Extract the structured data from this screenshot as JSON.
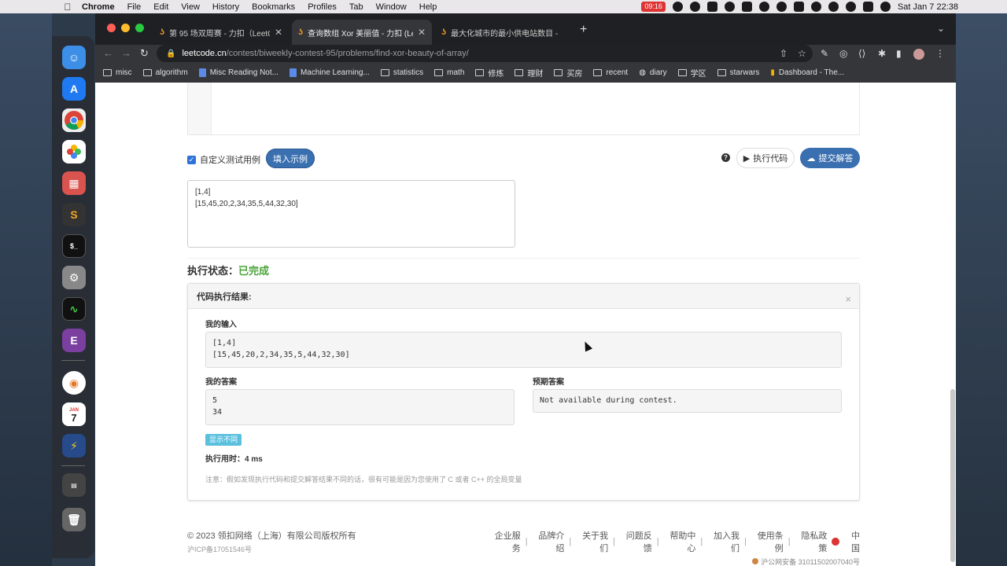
{
  "menubar": {
    "app_name": "Chrome",
    "items": [
      "File",
      "Edit",
      "View",
      "History",
      "Bookmarks",
      "Profiles",
      "Tab",
      "Window",
      "Help"
    ],
    "recording_time": "09:16",
    "clock": "Sat Jan 7  22:38"
  },
  "browser": {
    "tabs": [
      {
        "label": "第 95 场双周赛 - 力扣（LeetCo",
        "active": false
      },
      {
        "label": "查询数组 Xor 美丽值 - 力扣 (Le",
        "active": true
      },
      {
        "label": "最大化城市的最小供电站数目 - ",
        "active": false
      }
    ],
    "url_host": "leetcode.cn",
    "url_path": "/contest/biweekly-contest-95/problems/find-xor-beauty-of-array/",
    "bookmarks": [
      {
        "label": "misc",
        "type": "folder"
      },
      {
        "label": "algorithm",
        "type": "folder"
      },
      {
        "label": "Misc Reading Not...",
        "type": "doc"
      },
      {
        "label": "Machine Learning...",
        "type": "doc"
      },
      {
        "label": "statistics",
        "type": "folder"
      },
      {
        "label": "math",
        "type": "folder"
      },
      {
        "label": "修炼",
        "type": "folder"
      },
      {
        "label": "理财",
        "type": "folder"
      },
      {
        "label": "买房",
        "type": "folder"
      },
      {
        "label": "recent",
        "type": "folder"
      },
      {
        "label": "diary",
        "type": "globe"
      },
      {
        "label": "学区",
        "type": "folder"
      },
      {
        "label": "starwars",
        "type": "folder"
      },
      {
        "label": "Dashboard - The...",
        "type": "chart"
      }
    ]
  },
  "calendar": {
    "month": "JAN",
    "day": "7"
  },
  "controls": {
    "custom_test_label": "自定义测试用例",
    "fill_example_label": "填入示例",
    "help_glyph": "?",
    "run_label": "执行代码",
    "submit_label": "提交解答"
  },
  "testcase": {
    "lines": [
      "[1,4]",
      "[15,45,20,2,34,35,5,44,32,30]"
    ]
  },
  "status": {
    "label": "执行状态：",
    "value": "已完成"
  },
  "result": {
    "title": "代码执行结果:",
    "close_glyph": "×",
    "my_input_label": "我的输入",
    "my_input_lines": [
      "[1,4]",
      "[15,45,20,2,34,35,5,44,32,30]"
    ],
    "my_answer_label": "我的答案",
    "my_answer_lines": [
      "5",
      "34"
    ],
    "expected_label": "预期答案",
    "expected_value": "Not available during contest.",
    "show_diff_label": "显示不同",
    "runtime_label": "执行用时：",
    "runtime_value": "4 ms",
    "note": "注意：假如发现执行代码和提交解答结果不同的话，很有可能是因为您使用了 C 或者 C++ 的全局变量"
  },
  "footer": {
    "copyright": "© 2023 领扣网络（上海）有限公司版权所有",
    "icp": "沪ICP备17051546号",
    "links": [
      "企业服务",
      "品牌介绍",
      "关于我们",
      "问题反馈",
      "帮助中心",
      "加入我们",
      "使用条例",
      "隐私政策"
    ],
    "region": "中国",
    "police": "沪公网安备 31011502007040号"
  },
  "colors": {
    "accent_blue": "#3a6fb0",
    "success_green": "#4aa43a",
    "info_cyan": "#5bc0de"
  }
}
